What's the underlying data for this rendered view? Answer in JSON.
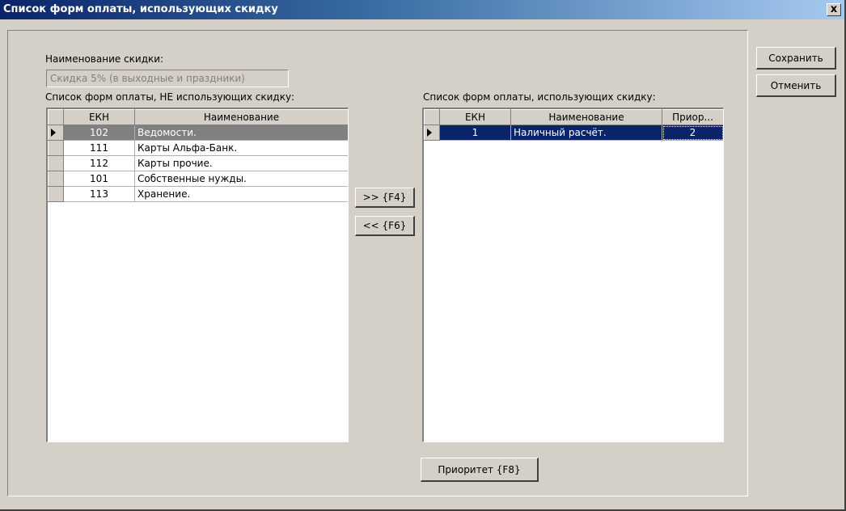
{
  "window": {
    "title": "Список форм оплаты, использующих скидку",
    "close_glyph": "x"
  },
  "discount": {
    "label": "Наименование скидки:",
    "value": "Скидка 5% (в выходные и праздники)"
  },
  "left_list": {
    "label": "Список форм оплаты, НЕ использующих скидку:",
    "columns": [
      "ЕКН",
      "Наименование"
    ],
    "rows": [
      {
        "ekn": "102",
        "name": "Ведомости."
      },
      {
        "ekn": "111",
        "name": "Карты Альфа-Банк."
      },
      {
        "ekn": "112",
        "name": "Карты прочие."
      },
      {
        "ekn": "101",
        "name": "Собственные нужды."
      },
      {
        "ekn": "113",
        "name": "Хранение."
      }
    ],
    "selected_index": 0
  },
  "right_list": {
    "label": "Список форм оплаты, использующих скидку:",
    "columns": [
      "ЕКН",
      "Наименование",
      "Приор..."
    ],
    "rows": [
      {
        "ekn": "1",
        "name": "Наличный расчёт.",
        "priority": "2"
      }
    ],
    "selected_index": 0
  },
  "buttons": {
    "move_right": ">> {F4}",
    "move_left": "<< {F6}",
    "priority": "Приоритет {F8}",
    "save": "Сохранить",
    "cancel": "Отменить"
  },
  "colors": {
    "face": "#d4d0c8",
    "title_start": "#0a246a",
    "title_end": "#a6caf0",
    "selection": "#0a246a",
    "inactive_selection": "#808080"
  }
}
